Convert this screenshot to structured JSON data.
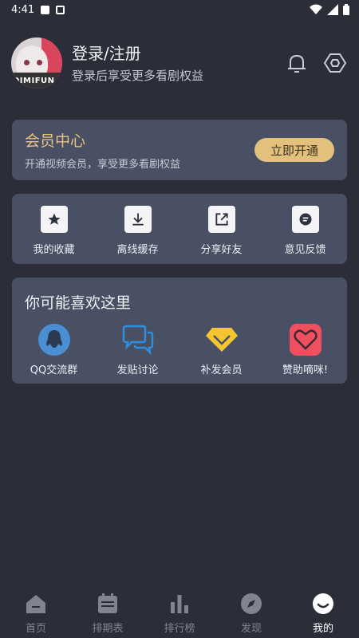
{
  "status_bar": {
    "time": "4:41",
    "icons": [
      "image-icon",
      "a-icon",
      "wifi-icon",
      "signal-icon",
      "battery-icon"
    ]
  },
  "profile": {
    "title": "登录/注册",
    "subtitle": "登录后享受更多看剧权益",
    "avatar_text": "DIMIFUN",
    "icons": [
      "bell-icon",
      "settings-hex-icon"
    ]
  },
  "vip": {
    "title": "会员中心",
    "subtitle": "开通视频会员，享受更多看剧权益",
    "button": "立即开通",
    "accent": "#e3c07b"
  },
  "actions": [
    {
      "label": "我的收藏",
      "icon": "star-icon"
    },
    {
      "label": "离线缓存",
      "icon": "download-icon"
    },
    {
      "label": "分享好友",
      "icon": "share-icon"
    },
    {
      "label": "意见反馈",
      "icon": "feedback-icon"
    }
  ],
  "like_section": {
    "title": "你可能喜欢这里",
    "items": [
      {
        "label": "QQ交流群",
        "icon": "qq-icon",
        "color": "#4a8fd4"
      },
      {
        "label": "发贴讨论",
        "icon": "chat-icon",
        "color": "#2f8ee0"
      },
      {
        "label": "补发会员",
        "icon": "diamond-icon",
        "color": "#f4c531"
      },
      {
        "label": "赞助嘀咪!",
        "icon": "heart-icon",
        "color": "#ef5060"
      }
    ]
  },
  "tabs": [
    {
      "label": "首页",
      "icon": "home-icon",
      "active": false
    },
    {
      "label": "排期表",
      "icon": "calendar-icon",
      "active": false
    },
    {
      "label": "排行榜",
      "icon": "bar-chart-icon",
      "active": false
    },
    {
      "label": "发现",
      "icon": "compass-icon",
      "active": false
    },
    {
      "label": "我的",
      "icon": "smile-icon",
      "active": true
    }
  ]
}
